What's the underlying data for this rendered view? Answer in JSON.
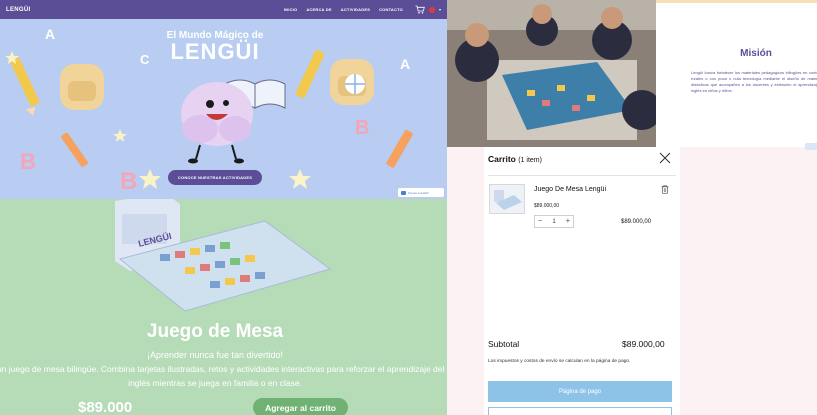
{
  "site": {
    "logo": "LENGÜI",
    "nav": [
      "INICIO",
      "ACERCA DE",
      "ACTIVIDADES",
      "CONTACTO"
    ],
    "lang_caret": "▾"
  },
  "hero": {
    "title_line1": "El Mundo Mágico de",
    "title_line2": "LENGÜI",
    "cta": "CONOCE NUESTRAS ACTIVIDADES",
    "chat": "Tienes a duda?"
  },
  "product": {
    "title": "Juego de Mesa",
    "subtitle": "¡Aprender nunca fue tan divertido!",
    "description": "es un juego de mesa bilingüe. Combina tarjetas ilustradas, retos y actividades interactivas para reforzar el aprendizaje del inglés mientras se juega en familia o en clase.",
    "price": "$89.000",
    "add_to_cart": "Agregar al carrito"
  },
  "mision": {
    "title": "Misión",
    "text": "Lengüi busca fortalecer los materiales pedagógicos bilingües en contextos rurales o con poca o nula tecnología mediante el diseño de materiales didácticos que acompañen a los docentes y estimulen el aprendizaje del inglés en niños y niños."
  },
  "cart": {
    "title": "Carrito",
    "count": "(1 item)",
    "item": {
      "name": "Juego De Mesa Lengüi",
      "unit_price": "$89.000,00",
      "qty": "1",
      "minus": "−",
      "plus": "+",
      "line_total": "$89.000,00"
    },
    "subtotal_label": "Subtotal",
    "subtotal_value": "$89.000,00",
    "tax_note": "Los impuestos y costos de envío se calculan en la página de pago.",
    "checkout": "Página de pago"
  },
  "colors": {
    "brand_purple": "#5b4e96",
    "hero_blue": "#b8cdf1",
    "product_green": "#b5dbb7",
    "button_green": "#6fb273",
    "checkout_blue": "#8ec3e8"
  }
}
